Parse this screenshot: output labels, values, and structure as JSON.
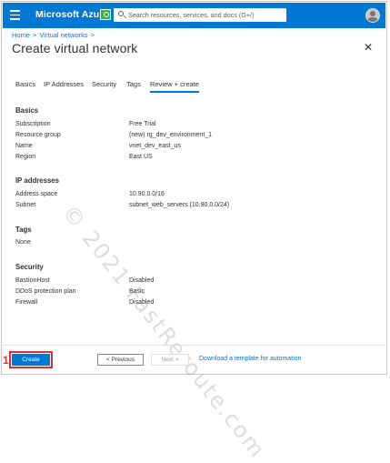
{
  "topbar": {
    "brand": "Microsoft Azure",
    "search_placeholder": "Search resources, services, and docs (G+/)"
  },
  "breadcrumb": [
    "Home",
    "Virtual networks"
  ],
  "breadcrumb_sep": ">",
  "page_title": "Create virtual network",
  "close_glyph": "✕",
  "tabs": [
    "Basics",
    "IP Addresses",
    "Security",
    "Tags",
    "Review + create"
  ],
  "active_tab": "Review + create",
  "sections": {
    "basics": {
      "heading": "Basics",
      "rows": [
        {
          "label": "Subscription",
          "value": "Free Trial"
        },
        {
          "label": "Resource group",
          "value": "(new) rg_dev_environment_1"
        },
        {
          "label": "Name",
          "value": "vnet_dev_east_us"
        },
        {
          "label": "Region",
          "value": "East US"
        }
      ]
    },
    "ip": {
      "heading": "IP addresses",
      "rows": [
        {
          "label": "Address space",
          "value": "10.90.0.0/16"
        },
        {
          "label": "Subnet",
          "value": "subnet_web_servers (10.90.0.0/24)"
        }
      ]
    },
    "tags": {
      "heading": "Tags",
      "rows": [
        {
          "label": "None",
          "value": ""
        }
      ]
    },
    "security": {
      "heading": "Security",
      "rows": [
        {
          "label": "BastionHost",
          "value": "Disabled"
        },
        {
          "label": "DDoS protection plan",
          "value": "Basic"
        },
        {
          "label": "Firewall",
          "value": "Disabled"
        }
      ]
    }
  },
  "footer": {
    "step_number": "1",
    "create": "Create",
    "previous": "< Previous",
    "next": "Next >",
    "download": "Download a template for automation"
  },
  "watermark": "© 2021 FastReroute.com",
  "colors": {
    "accent": "#0078d4",
    "highlight": "#d13438"
  }
}
